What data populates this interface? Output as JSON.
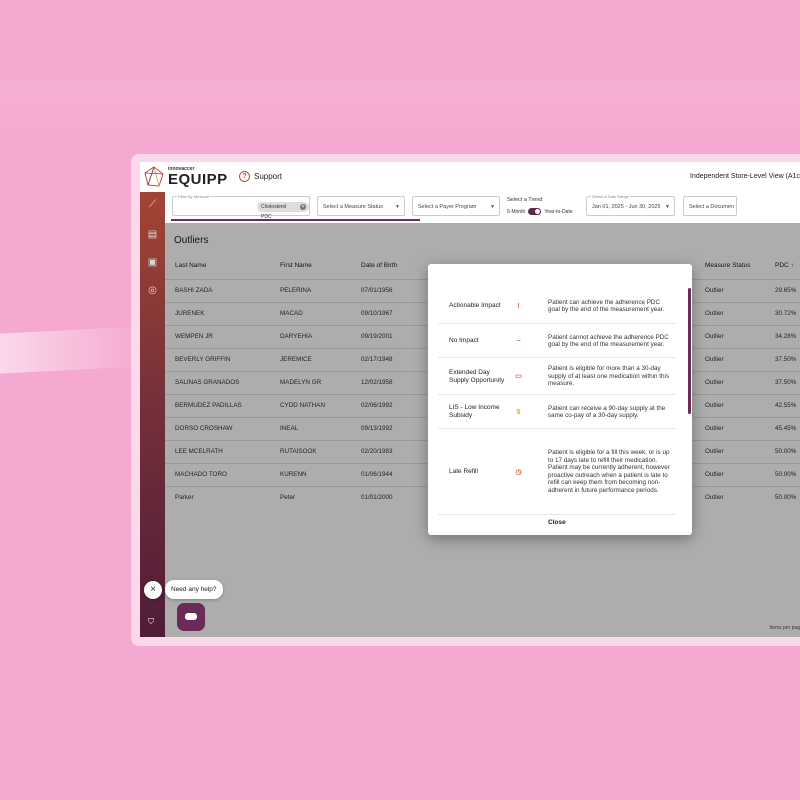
{
  "app": {
    "logo_small": "innovaccer",
    "logo_big": "EQUIPP",
    "support_label": "Support",
    "view_title": "Independent Store-Level View (A1c"
  },
  "filters": {
    "measure_label": "Filter By Measure",
    "measure_chip": "Cholesterol PDC",
    "measure_status_placeholder": "Select a Measure Status",
    "payer_placeholder": "Select a Payer Program",
    "trend_label": "Select a Trend",
    "trend_left": "6-Month",
    "trend_right": "Year-to-Date",
    "date_label": "Select a Date Range",
    "date_value": "Jan 01, 2025 - Jun 30, 2025",
    "document_placeholder": "Select a Documen"
  },
  "page": {
    "title": "Outliers",
    "items_per_page": "Items per pag"
  },
  "table": {
    "headers": [
      "Last Name",
      "First Name",
      "Date of Birth",
      "Measure Status",
      "PDC ↑"
    ],
    "rows": [
      {
        "last": "BASHI ZADA",
        "first": "PELERINA",
        "dob": "07/01/1956",
        "status": "Outlier",
        "pdc": "29.65%"
      },
      {
        "last": "JURENEK",
        "first": "MACAD",
        "dob": "09/10/1967",
        "status": "Outlier",
        "pdc": "30.72%"
      },
      {
        "last": "WEMPEN JR",
        "first": "DARYEHIA",
        "dob": "09/19/2001",
        "status": "Outlier",
        "pdc": "34.28%"
      },
      {
        "last": "BEVERLY GRIFFIN",
        "first": "JEREMICE",
        "dob": "02/17/1948",
        "status": "Outlier",
        "pdc": "37.50%"
      },
      {
        "last": "SALINAS GRANADOS",
        "first": "MADELYN GR",
        "dob": "12/02/1958",
        "status": "Outlier",
        "pdc": "37.50%"
      },
      {
        "last": "BERMUDEZ PADILLAS",
        "first": "CYDD NATHAN",
        "dob": "02/06/1992",
        "status": "Outlier",
        "pdc": "42.55%"
      },
      {
        "last": "DORSO CROSHAW",
        "first": "INEAL",
        "dob": "09/13/1992",
        "status": "Outlier",
        "pdc": "45.45%"
      },
      {
        "last": "LEE MCELRATH",
        "first": "RUTAISOOK",
        "dob": "02/20/1983",
        "status": "Outlier",
        "pdc": "50.00%"
      },
      {
        "last": "MACHADO TORO",
        "first": "KURENN",
        "dob": "01/06/1944",
        "status": "Outlier",
        "pdc": "50.00%"
      },
      {
        "last": "Parker",
        "first": "Peter",
        "dob": "01/01/2000",
        "status": "Outlier",
        "pdc": "50.00%"
      }
    ]
  },
  "modal": {
    "items": [
      {
        "name": "Actionable Impact",
        "icon": "exclamation-icon",
        "glyph": "!",
        "color": "#e0643c",
        "desc": "Patient can achieve the adherence PDC goal by the end of the measurement year."
      },
      {
        "name": "No Impact",
        "icon": "minus-circle-icon",
        "glyph": "−",
        "color": "#e0643c",
        "desc": "Patient cannot achieve the adherence PDC goal by the end of the measurement year."
      },
      {
        "name": "Extended Day Supply Opportunity",
        "icon": "calendar-icon",
        "glyph": "▭",
        "color": "#e0643c",
        "desc": "Patient is eligible for more than a 30-day supply of at least one medication within this measure."
      },
      {
        "name": "LIS - Low Income Subsidy",
        "icon": "dollar-swap-icon",
        "glyph": "$",
        "color": "#e8a24a",
        "desc": "Patient can receive a 90-day supply at the same co-pay of a 30-day supply."
      },
      {
        "name": "Late Refill",
        "icon": "stopwatch-icon",
        "glyph": "◷",
        "color": "#e0643c",
        "desc": "Patient is eligible for a fill this week, or is up to 17 days late to refill their medication. Patient may be currently adherent, however proactive outreach when a patient is late to refill can keep them from becoming non-adherent in future performance periods."
      }
    ],
    "close_label": "Close"
  },
  "help": {
    "bubble": "Need any help?"
  },
  "colors": {
    "background": "#f5a9d1",
    "brand": "#6b2a57",
    "accent": "#c04a3f"
  }
}
